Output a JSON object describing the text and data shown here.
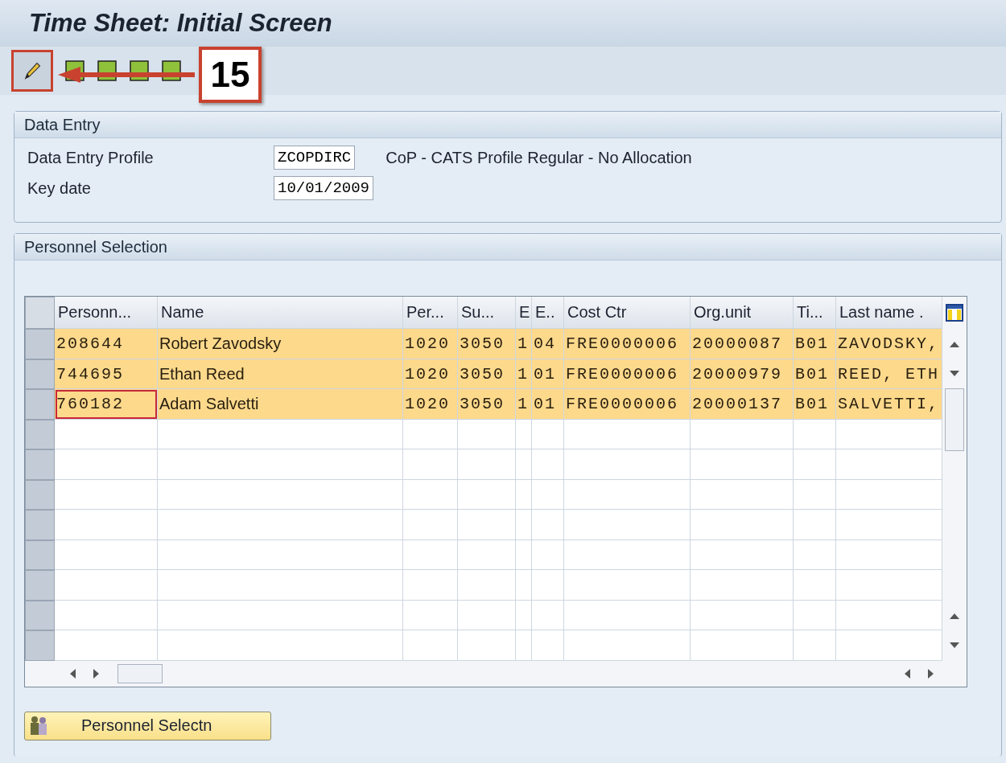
{
  "window": {
    "title": "Time Sheet: Initial Screen"
  },
  "toolbar": {
    "items": [
      {
        "kind": "edit",
        "highlighted": true
      },
      {
        "kind": "tool",
        "highlighted": false
      },
      {
        "kind": "tool",
        "highlighted": false
      },
      {
        "kind": "tool",
        "highlighted": false
      },
      {
        "kind": "tool",
        "highlighted": false
      }
    ]
  },
  "annotation": {
    "callout": "15"
  },
  "data_entry": {
    "title": "Data Entry",
    "fields": [
      {
        "label": "Data Entry Profile",
        "value": "ZCOPDIRC",
        "description": "CoP - CATS Profile Regular - No Allocation"
      },
      {
        "label": "Key date",
        "value": "10/01/2009"
      }
    ]
  },
  "personnel_selection": {
    "title": "Personnel Selection",
    "table": {
      "columns": [
        "Personn...",
        "Name",
        "Per...",
        "Su...",
        "E",
        "E..",
        "Cost Ctr",
        "Org.unit",
        "Ti...",
        "Last name ."
      ],
      "rows": [
        {
          "cells": [
            "208644",
            "Robert Zavodsky",
            "1020",
            "3050",
            "1",
            "04",
            "FRE0000006",
            "20000087",
            "B01",
            "ZAVODSKY,"
          ],
          "focused": false
        },
        {
          "cells": [
            "744695",
            "Ethan Reed",
            "1020",
            "3050",
            "1",
            "01",
            "FRE0000006",
            "20000979",
            "B01",
            "REED, ETH"
          ],
          "focused": false
        },
        {
          "cells": [
            "760182",
            "Adam Salvetti",
            "1020",
            "3050",
            "1",
            "01",
            "FRE0000006",
            "20000137",
            "B01",
            "SALVETTI,"
          ],
          "focused": true
        }
      ]
    },
    "button": "Personnel Selectn"
  }
}
